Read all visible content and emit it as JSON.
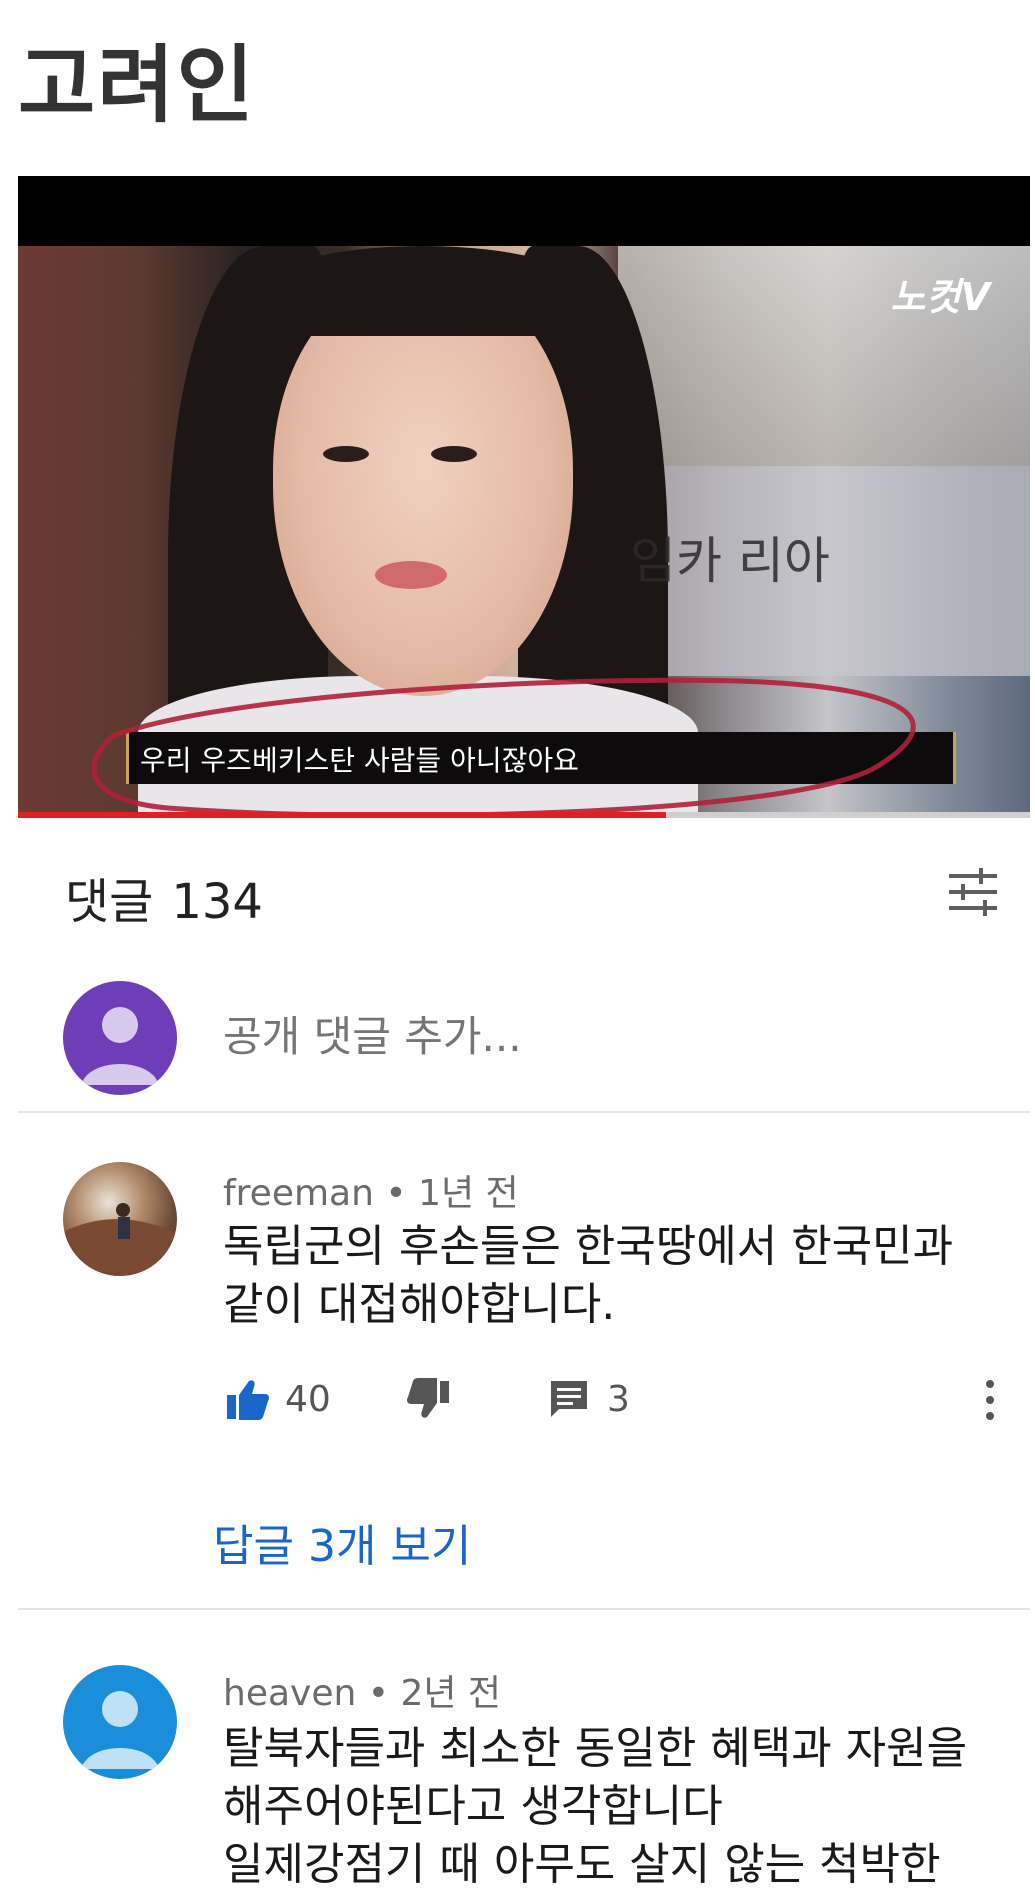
{
  "page_title": "고려인",
  "video": {
    "logo": "노컷V",
    "background_text": "임카  리아",
    "subtitle": "우리 우즈베키스탄 사람들 아니잖아요",
    "progress": 0.64
  },
  "comments_section": {
    "label": "댓글",
    "count": "134",
    "sort_icon": "sort-filter-icon",
    "add_comment_placeholder": "공개 댓글 추가..."
  },
  "comments": [
    {
      "author": "freeman",
      "time": "1년 전",
      "text_lines": [
        "독립군의 후손들은 한국땅에서 한국민과",
        "같이 대접해야합니다."
      ],
      "likes": "40",
      "replies": "3",
      "view_replies_label": "답글 3개 보기"
    },
    {
      "author": "heaven",
      "time": "2년 전",
      "text_lines": [
        "탈북자들과 최소한 동일한 혜택과 자원을",
        "해주어야된다고 생각합니다",
        "일제강점기 때 아무도 살지 않는 척박한"
      ]
    }
  ],
  "colors": {
    "accent_blue": "#1a67c9",
    "progress_red": "#e02020",
    "annotation_red": "#b0203a",
    "avatar_purple": "#6e3db8",
    "avatar_blue": "#1a8ed9"
  },
  "separator": "•"
}
